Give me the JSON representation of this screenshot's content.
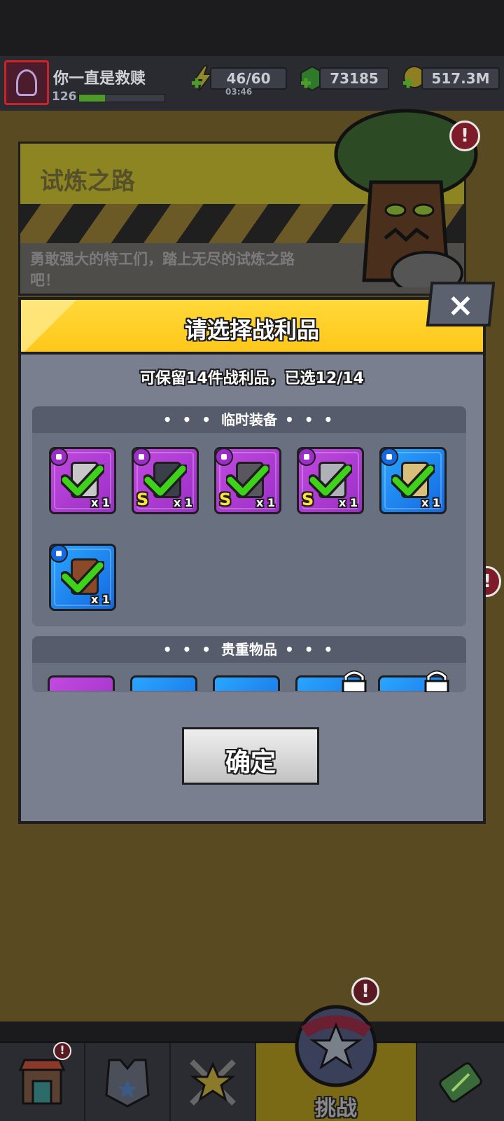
{
  "player": {
    "name": "你一直是救赎",
    "level": "126",
    "level_progress": 0.3
  },
  "resources": {
    "energy": "46/60",
    "energy_timer": "03:46",
    "gems": "73185",
    "gold": "517.3M"
  },
  "trial": {
    "title": "试炼之路",
    "description": "勇敢强大的特工们，踏上无尽的试炼之路吧！"
  },
  "dialog": {
    "title": "请选择战利品",
    "close_label": "×",
    "select_info": "可保留14件战利品，已选12/14",
    "sections": {
      "temp_equipment": {
        "title": "临时装备",
        "items": [
          {
            "icon": "dagger-icon",
            "grade": "",
            "qty": "x 1",
            "rarity": "purple",
            "checked": true
          },
          {
            "icon": "armor-vest-icon",
            "grade": "S",
            "qty": "x 1",
            "rarity": "purple",
            "checked": true
          },
          {
            "icon": "spiked-armor-icon",
            "grade": "S",
            "qty": "x 1",
            "rarity": "purple",
            "checked": true
          },
          {
            "icon": "belt-icon",
            "grade": "S",
            "qty": "x 1",
            "rarity": "purple",
            "checked": true
          },
          {
            "icon": "jacket-icon",
            "grade": "",
            "qty": "x 1",
            "rarity": "blue",
            "checked": true
          },
          {
            "icon": "boots-icon",
            "grade": "",
            "qty": "x 1",
            "rarity": "blue",
            "checked": true
          }
        ]
      },
      "valuables": {
        "title": "贵重物品"
      }
    },
    "confirm_label": "确定"
  },
  "nav": {
    "active_label": "挑战"
  },
  "colors": {
    "header_yellow": "#ffc71a",
    "dialog_bg": "#7a7f8f",
    "purple_rarity": "#9b2ec6",
    "blue_rarity": "#1468e0",
    "check_green": "#3fd21a",
    "alert_red": "#c8243a"
  }
}
